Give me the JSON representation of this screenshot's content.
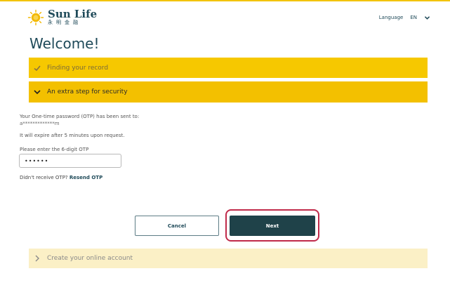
{
  "header": {
    "brand_name": "Sun Life",
    "brand_chinese": "永明金融",
    "language_label": "Language",
    "language_value": "EN"
  },
  "welcome": "Welcome!",
  "steps": [
    {
      "label": "Finding your record",
      "state": "completed",
      "icon": "check-icon"
    },
    {
      "label": "An extra step for security",
      "state": "active",
      "icon": "chevron-down-icon"
    },
    {
      "label": "Create your online account",
      "state": "upcoming",
      "icon": "chevron-right-icon"
    }
  ],
  "otp": {
    "sent_text": "Your One-time password (OTP) has been sent to:",
    "masked_email": "a*************m",
    "expiry_text": "It will expire after 5 minutes upon request.",
    "input_label": "Please enter the 6-digit OTP",
    "input_value": "••••••",
    "resend_prompt": "Didn't receive OTP?",
    "resend_link": "Resend OTP"
  },
  "buttons": {
    "cancel": "Cancel",
    "next": "Next"
  },
  "colors": {
    "brand_yellow": "#f6c800",
    "brand_dark_teal": "#1f4249",
    "highlight_red": "#c02a4a",
    "upcoming_step": "#fbf0c6"
  }
}
